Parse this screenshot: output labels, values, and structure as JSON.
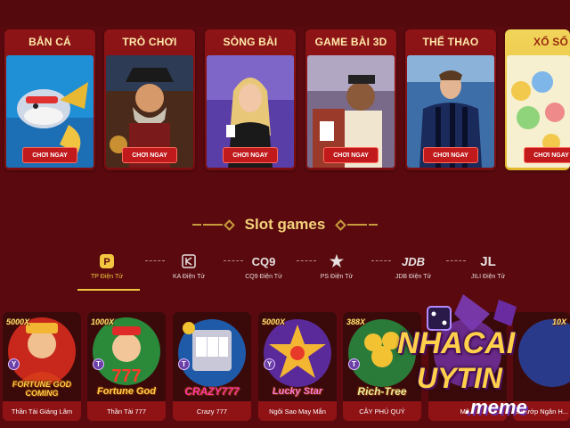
{
  "categories": [
    {
      "title": "BẮN CÁ",
      "button": "CHƠI NGAY"
    },
    {
      "title": "TRÒ CHƠI",
      "button": "CHƠI NGAY"
    },
    {
      "title": "SÒNG BÀI",
      "button": "CHƠI NGAY"
    },
    {
      "title": "GAME BÀI 3D",
      "button": "CHƠI NGAY"
    },
    {
      "title": "THỂ THAO",
      "button": "CHƠI NGAY"
    },
    {
      "title": "XỔ SỐ",
      "button": "CHƠI NGAY"
    }
  ],
  "section": {
    "title": "Slot games"
  },
  "providers": [
    {
      "logo": "P",
      "label": "TP Điện Tử",
      "active": true
    },
    {
      "logo": "KA",
      "label": "KA Điện Tử",
      "active": false
    },
    {
      "logo": "CQ9",
      "label": "CQ9 Điện Tử",
      "active": false
    },
    {
      "logo": "★",
      "label": "PS Điện Tử",
      "active": false
    },
    {
      "logo": "JDB",
      "label": "JDB Điện Tử",
      "active": false
    },
    {
      "logo": "JL",
      "label": "JILI Điện Tử",
      "active": false
    }
  ],
  "games": [
    {
      "name": "Thần Tài Giáng Lâm",
      "logo": "FORTUNE GOD COMING",
      "jackpot": "5000X"
    },
    {
      "name": "Thần Tài 777",
      "logo": "Fortune God",
      "jackpot": "1000X"
    },
    {
      "name": "Crazy 777",
      "logo": "CRAZY777",
      "jackpot": ""
    },
    {
      "name": "Ngôi Sao May Mắn",
      "logo": "Lucky Star",
      "jackpot": "5000X"
    },
    {
      "name": "CÂY PHÚ QUÝ",
      "logo": "Rich-Tree",
      "jackpot": "388X"
    },
    {
      "name": "Mã...",
      "logo": "",
      "jackpot": ""
    },
    {
      "name": "Kẻ Cướp Ngân H...",
      "logo": "",
      "jackpot": "10X"
    }
  ],
  "watermark": {
    "line1": "NHACAI",
    "line2": "UYTIN",
    "line3": ".meme"
  },
  "colors": {
    "background": "#5a0a0e",
    "card": "#8e1416",
    "gold": "#f3c640",
    "button": "#c01a1c"
  }
}
